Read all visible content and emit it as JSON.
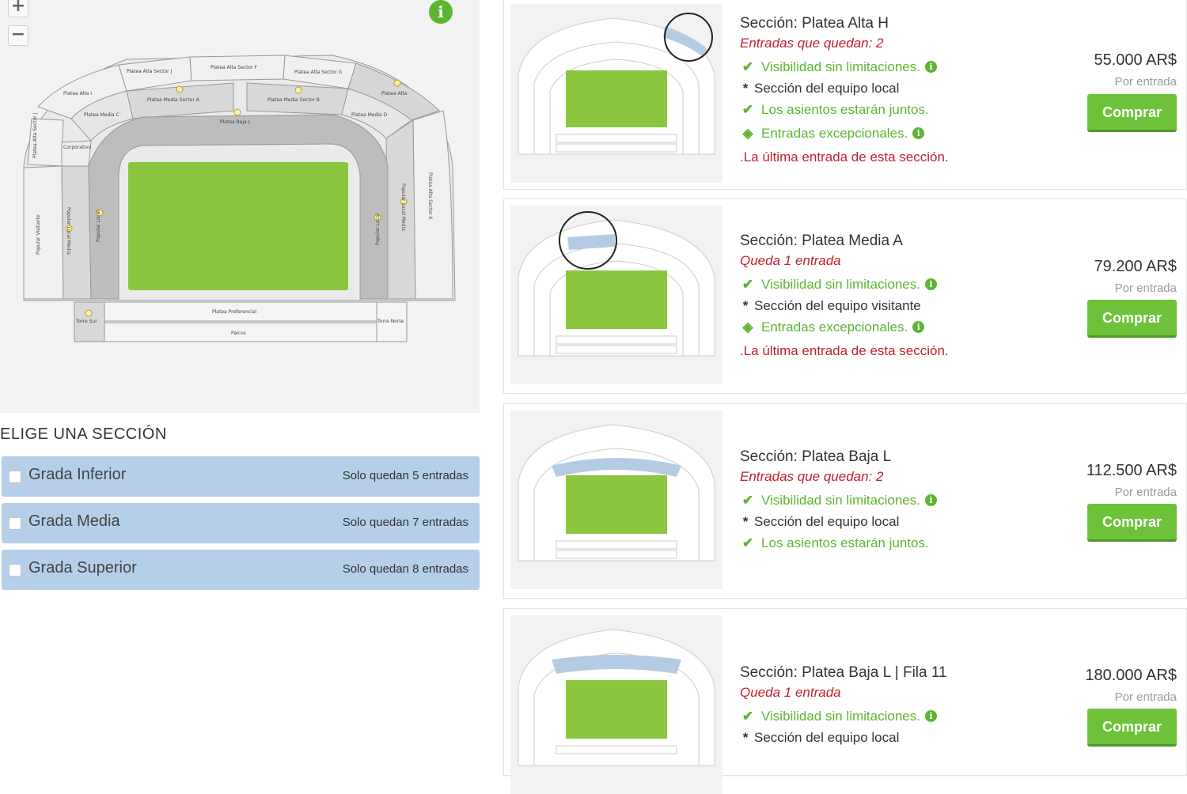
{
  "map": {
    "zoom_in_label": "+",
    "zoom_out_label": "−",
    "info_label": "i",
    "sections": {
      "alta_sector_j": "Platea Alta Sector J",
      "alta_sector_f": "Platea Alta Sector F",
      "alta_sector_g": "Platea Alta Sector G",
      "alta_i": "Platea Alta I",
      "alta": "Platea Alta",
      "media_sector_a": "Platea Media Sector A",
      "media_sector_b": "Platea Media Sector B",
      "media_c": "Platea Media C",
      "media_d": "Platea Media D",
      "baja_l": "Platea Baja L",
      "corporativo": "Corporativo",
      "alta_sector_k_left": "Platea Alta Sector J",
      "popular_visitante": "Popular Visitante",
      "popular_local_media_left": "Popular Local Media",
      "popular_local_left": "Popular Local",
      "popular_local_right": "Popular Local",
      "popular_local_media_right": "Popular Local Media",
      "alta_sector_k_right": "Platea Alta Sector K",
      "preferencial": "Platea Preferencial",
      "palcos": "Palcos",
      "torre_sur": "Torre Sur",
      "torre_norte": "Torre Norte"
    }
  },
  "chooser": {
    "header": "ELIGE UNA SECCIÓN",
    "tiers": [
      {
        "name": "Grada Inferior",
        "availability": "Solo quedan 5 entradas"
      },
      {
        "name": "Grada Media",
        "availability": "Solo quedan 7 entradas"
      },
      {
        "name": "Grada Superior",
        "availability": "Solo quedan 8 entradas"
      }
    ]
  },
  "listings": [
    {
      "title": "Sección: Platea Alta H",
      "quantity": "Entradas que quedan: 2",
      "visibility": "Visibilidad sin limitaciones.",
      "team": "Sección del equipo local",
      "together": "Los asientos estarán juntos.",
      "exceptional": "Entradas excepcionales.",
      "last": ".La última entrada de esta sección.",
      "price": "55.000 AR$",
      "per": "Por entrada",
      "buy": "Comprar"
    },
    {
      "title": "Sección: Platea Media A",
      "quantity": "Queda 1 entrada",
      "visibility": "Visibilidad sin limitaciones.",
      "team": "Sección del equipo visitante",
      "exceptional": "Entradas excepcionales.",
      "last": ".La última entrada de esta sección.",
      "price": "79.200 AR$",
      "per": "Por entrada",
      "buy": "Comprar"
    },
    {
      "title": "Sección: Platea Baja L",
      "quantity": "Entradas que quedan: 2",
      "visibility": "Visibilidad sin limitaciones.",
      "team": "Sección del equipo local",
      "together": "Los asientos estarán juntos.",
      "price": "112.500 AR$",
      "per": "Por entrada",
      "buy": "Comprar"
    },
    {
      "title": "Sección: Platea Baja L | Fila 11",
      "quantity": "Queda 1 entrada",
      "visibility": "Visibilidad sin limitaciones.",
      "team": "Sección del equipo local",
      "price": "180.000 AR$",
      "per": "Por entrada",
      "buy": "Comprar"
    }
  ],
  "colors": {
    "pitch": "#8cc63f",
    "accent_green": "#5cb531",
    "button_green": "#6dc23a",
    "alert_red": "#c0202a",
    "tier_blue": "#b5cfe8",
    "highlight_blue": "#b4cce3"
  },
  "icons": {
    "check": "check-icon",
    "info": "info-icon",
    "diamond": "diamond-icon",
    "asterisk": "asterisk-icon"
  }
}
